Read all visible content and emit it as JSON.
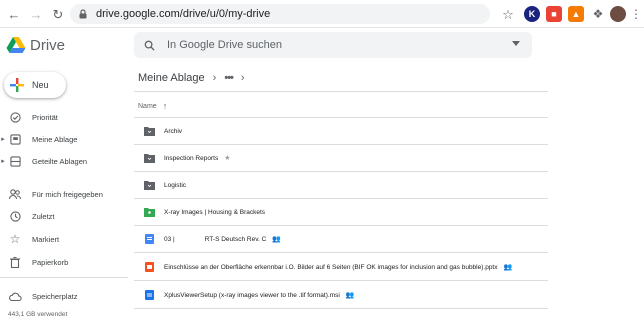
{
  "browser": {
    "url": "drive.google.com/drive/u/0/my-drive"
  },
  "drive": {
    "app_name": "Drive",
    "search_placeholder": "In Google Drive suchen",
    "new_label": "Neu"
  },
  "sidebar": {
    "items": [
      {
        "label": "Priorität"
      },
      {
        "label": "Meine Ablage"
      },
      {
        "label": "Geteilte Ablagen"
      },
      {
        "label": "Für mich freigegeben"
      },
      {
        "label": "Zuletzt"
      },
      {
        "label": "Markiert"
      },
      {
        "label": "Papierkorb"
      },
      {
        "label": "Speicherplatz"
      }
    ],
    "storage_used": "443,1 GB verwendet"
  },
  "main": {
    "breadcrumb": "Meine Ablage",
    "sort_column": "Name",
    "files": [
      {
        "name": "Archiv",
        "type": "folder"
      },
      {
        "name": "Inspection Reports",
        "type": "folder",
        "starred": true
      },
      {
        "name": "Logistic",
        "type": "folder"
      },
      {
        "name": "X-ray Images | Housing & Brackets",
        "type": "shared-folder"
      },
      {
        "name_part1": "03 |",
        "name_part2": "RT-S Deutsch Rev. C",
        "type": "doc",
        "shared": true
      },
      {
        "name": "Einschlüsse an der Oberfläche erkennbar i.O. Bilder auf 6 Seiten (BIF OK images for inclusion and gas bubble).pptx",
        "type": "pptx",
        "shared": true
      },
      {
        "name": "XplusViewerSetup (x-ray images viewer to the .tif format).msi",
        "type": "msi",
        "shared": true
      }
    ]
  },
  "colors": {
    "folder": "#5f6368",
    "shared_folder": "#34a853",
    "doc": "#4285f4",
    "pptx": "#f4511e",
    "accent_blue": "#1a73e8"
  }
}
